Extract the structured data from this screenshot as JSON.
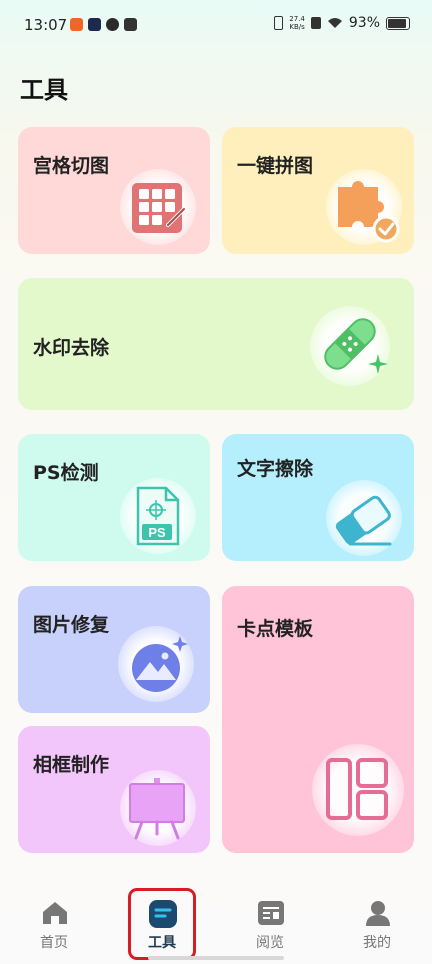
{
  "status_bar": {
    "time": "13:07",
    "net_speed_top": "27.4",
    "net_speed_bottom": "KB/s",
    "battery": "93%"
  },
  "page": {
    "title": "工具"
  },
  "tools": [
    {
      "label": "宫格切图",
      "icon": "grid-image-icon",
      "color": "#ffd8d8"
    },
    {
      "label": "一键拼图",
      "icon": "puzzle-icon",
      "color": "#ffefbd"
    },
    {
      "label": "水印去除",
      "icon": "bandage-icon",
      "color": "#e3f9cc"
    },
    {
      "label": "PS检测",
      "icon": "ps-file-icon",
      "color": "#cffbee"
    },
    {
      "label": "文字擦除",
      "icon": "eraser-icon",
      "color": "#b5eefc"
    },
    {
      "label": "图片修复",
      "icon": "image-repair-icon",
      "color": "#c8d0fc"
    },
    {
      "label": "卡点模板",
      "icon": "layout-template-icon",
      "color": "#ffc4d8"
    },
    {
      "label": "相框制作",
      "icon": "easel-frame-icon",
      "color": "#f2c6fb"
    }
  ],
  "nav": {
    "items": [
      {
        "label": "首页",
        "icon": "home-icon"
      },
      {
        "label": "工具",
        "icon": "tools-icon"
      },
      {
        "label": "阅览",
        "icon": "browse-icon"
      },
      {
        "label": "我的",
        "icon": "profile-icon"
      }
    ],
    "active": "工具"
  }
}
